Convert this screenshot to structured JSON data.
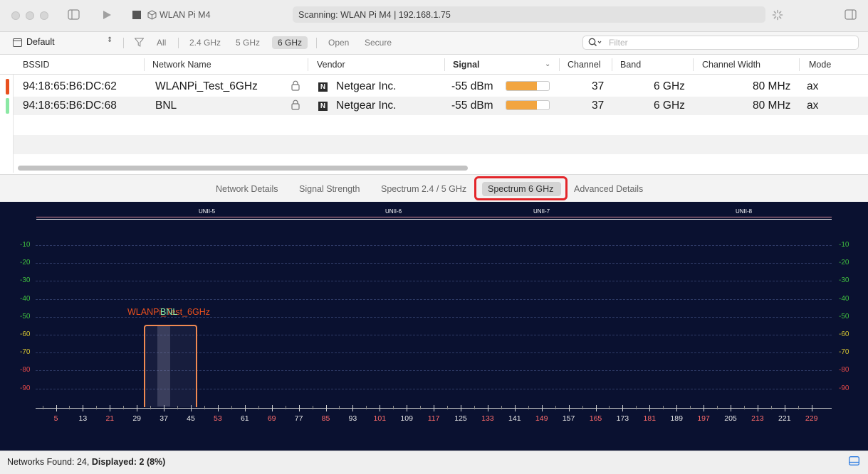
{
  "toolbar": {
    "device_name": "WLAN Pi M4",
    "status": "Scanning: WLAN Pi M4 | 192.168.1.75"
  },
  "filterbar": {
    "preset": "Default",
    "filters": [
      "All",
      "2.4 GHz",
      "5 GHz",
      "6 GHz",
      "Open",
      "Secure"
    ],
    "selected_filter": "6 GHz",
    "search_placeholder": "Filter"
  },
  "table": {
    "columns": [
      "BSSID",
      "Network Name",
      "Vendor",
      "Signal",
      "Channel",
      "Band",
      "Channel Width",
      "Mode"
    ],
    "rows": [
      {
        "bssid": "94:18:65:B6:DC:62",
        "name": "WLANPi_Test_6GHz",
        "vendor": "Netgear Inc.",
        "vendor_logo": "N",
        "signal": "-55 dBm",
        "signal_fill": 0.72,
        "channel": "37",
        "band": "6 GHz",
        "width": "80 MHz",
        "mode": "ax",
        "indicator_color": "#e8501e"
      },
      {
        "bssid": "94:18:65:B6:DC:68",
        "name": "BNL",
        "vendor": "Netgear Inc.",
        "vendor_logo": "N",
        "signal": "-55 dBm",
        "signal_fill": 0.72,
        "channel": "37",
        "band": "6 GHz",
        "width": "80 MHz",
        "mode": "ax",
        "indicator_color": "#8be8a4"
      }
    ]
  },
  "tabs": [
    "Network Details",
    "Signal Strength",
    "Spectrum 2.4 / 5 GHz",
    "Spectrum 6 GHz",
    "Advanced Details"
  ],
  "active_tab": "Spectrum 6 GHz",
  "spectrum": {
    "bands": [
      "UNII-5",
      "UNII-6",
      "UNII-7",
      "UNII-8"
    ],
    "levels": [
      "-10",
      "-20",
      "-30",
      "-40",
      "-50",
      "-60",
      "-70",
      "-80",
      "-90"
    ],
    "channels": [
      "5",
      "13",
      "21",
      "29",
      "37",
      "45",
      "53",
      "61",
      "69",
      "77",
      "85",
      "93",
      "101",
      "109",
      "117",
      "125",
      "133",
      "141",
      "149",
      "157",
      "165",
      "173",
      "181",
      "189",
      "197",
      "205",
      "213",
      "221",
      "229"
    ],
    "networks": [
      {
        "name": "WLANPi_Test_6GHz",
        "color": "#e8501e"
      },
      {
        "name": "BNL",
        "color": "#8be8a4"
      }
    ]
  },
  "statusbar": {
    "found": "Networks Found: 24,",
    "displayed": "Displayed: 2 (8%)"
  },
  "colors": {
    "accent": "#e8501e",
    "highlight": "#e3262a",
    "spectrum_bg": "#0a1130"
  }
}
